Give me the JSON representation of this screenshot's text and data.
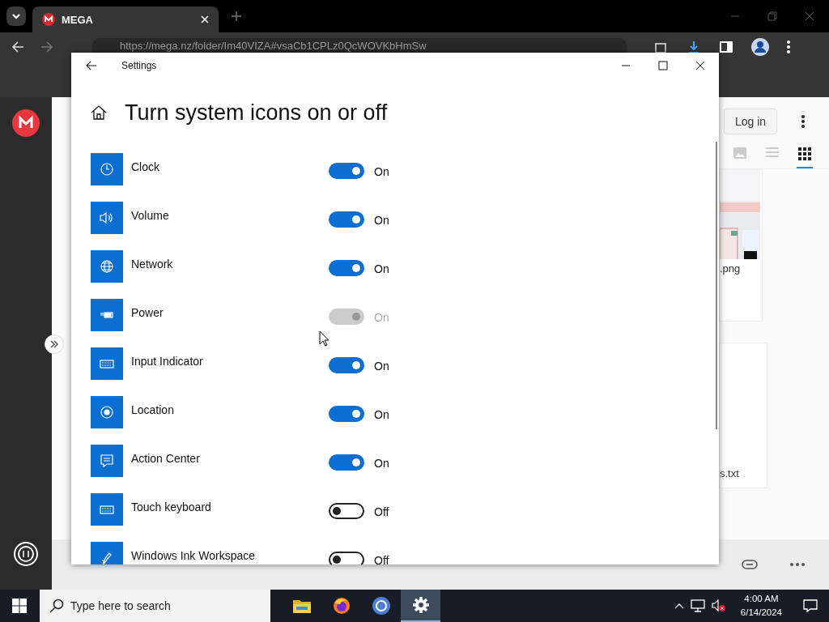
{
  "browser": {
    "tab": {
      "title": "MEGA"
    },
    "address": "https://mega.nz/folder/Im40VIZA#vsaCb1CPLz0QcWOVKbHmSw",
    "page": {
      "login": "Log in",
      "views": [
        {
          "kind": "thumbnail",
          "selected": false
        },
        {
          "kind": "list",
          "selected": false
        },
        {
          "kind": "grid",
          "selected": true
        }
      ],
      "files": [
        {
          "kind": "picture",
          "name": ".png"
        },
        {
          "kind": "text",
          "name": "s.txt"
        }
      ]
    }
  },
  "settings": {
    "title": "Settings",
    "heading": "Turn system icons on or off",
    "items": [
      {
        "kind": "clock",
        "label": "Clock",
        "on": true,
        "disabled": false,
        "state": "On"
      },
      {
        "kind": "volume",
        "label": "Volume",
        "on": true,
        "disabled": false,
        "state": "On"
      },
      {
        "kind": "network",
        "label": "Network",
        "on": true,
        "disabled": false,
        "state": "On"
      },
      {
        "kind": "power",
        "label": "Power",
        "on": true,
        "disabled": true,
        "state": "On"
      },
      {
        "kind": "keyboard",
        "label": "Input Indicator",
        "on": true,
        "disabled": false,
        "state": "On"
      },
      {
        "kind": "location",
        "label": "Location",
        "on": true,
        "disabled": false,
        "state": "On"
      },
      {
        "kind": "message",
        "label": "Action Center",
        "on": true,
        "disabled": false,
        "state": "On"
      },
      {
        "kind": "keyboard",
        "label": "Touch keyboard",
        "on": false,
        "disabled": false,
        "state": "Off"
      },
      {
        "kind": "pen",
        "label": "Windows Ink Workspace",
        "on": false,
        "disabled": false,
        "state": "Off"
      }
    ]
  },
  "taskbar": {
    "search": {
      "placeholder": "Type here to search"
    },
    "apps": [
      {
        "kind": "folder",
        "selected": false
      },
      {
        "kind": "firefox",
        "selected": false
      },
      {
        "kind": "chrome",
        "selected": false
      },
      {
        "kind": "gear",
        "selected": true
      }
    ],
    "time": "4:00 AM",
    "date": "6/14/2024"
  }
}
